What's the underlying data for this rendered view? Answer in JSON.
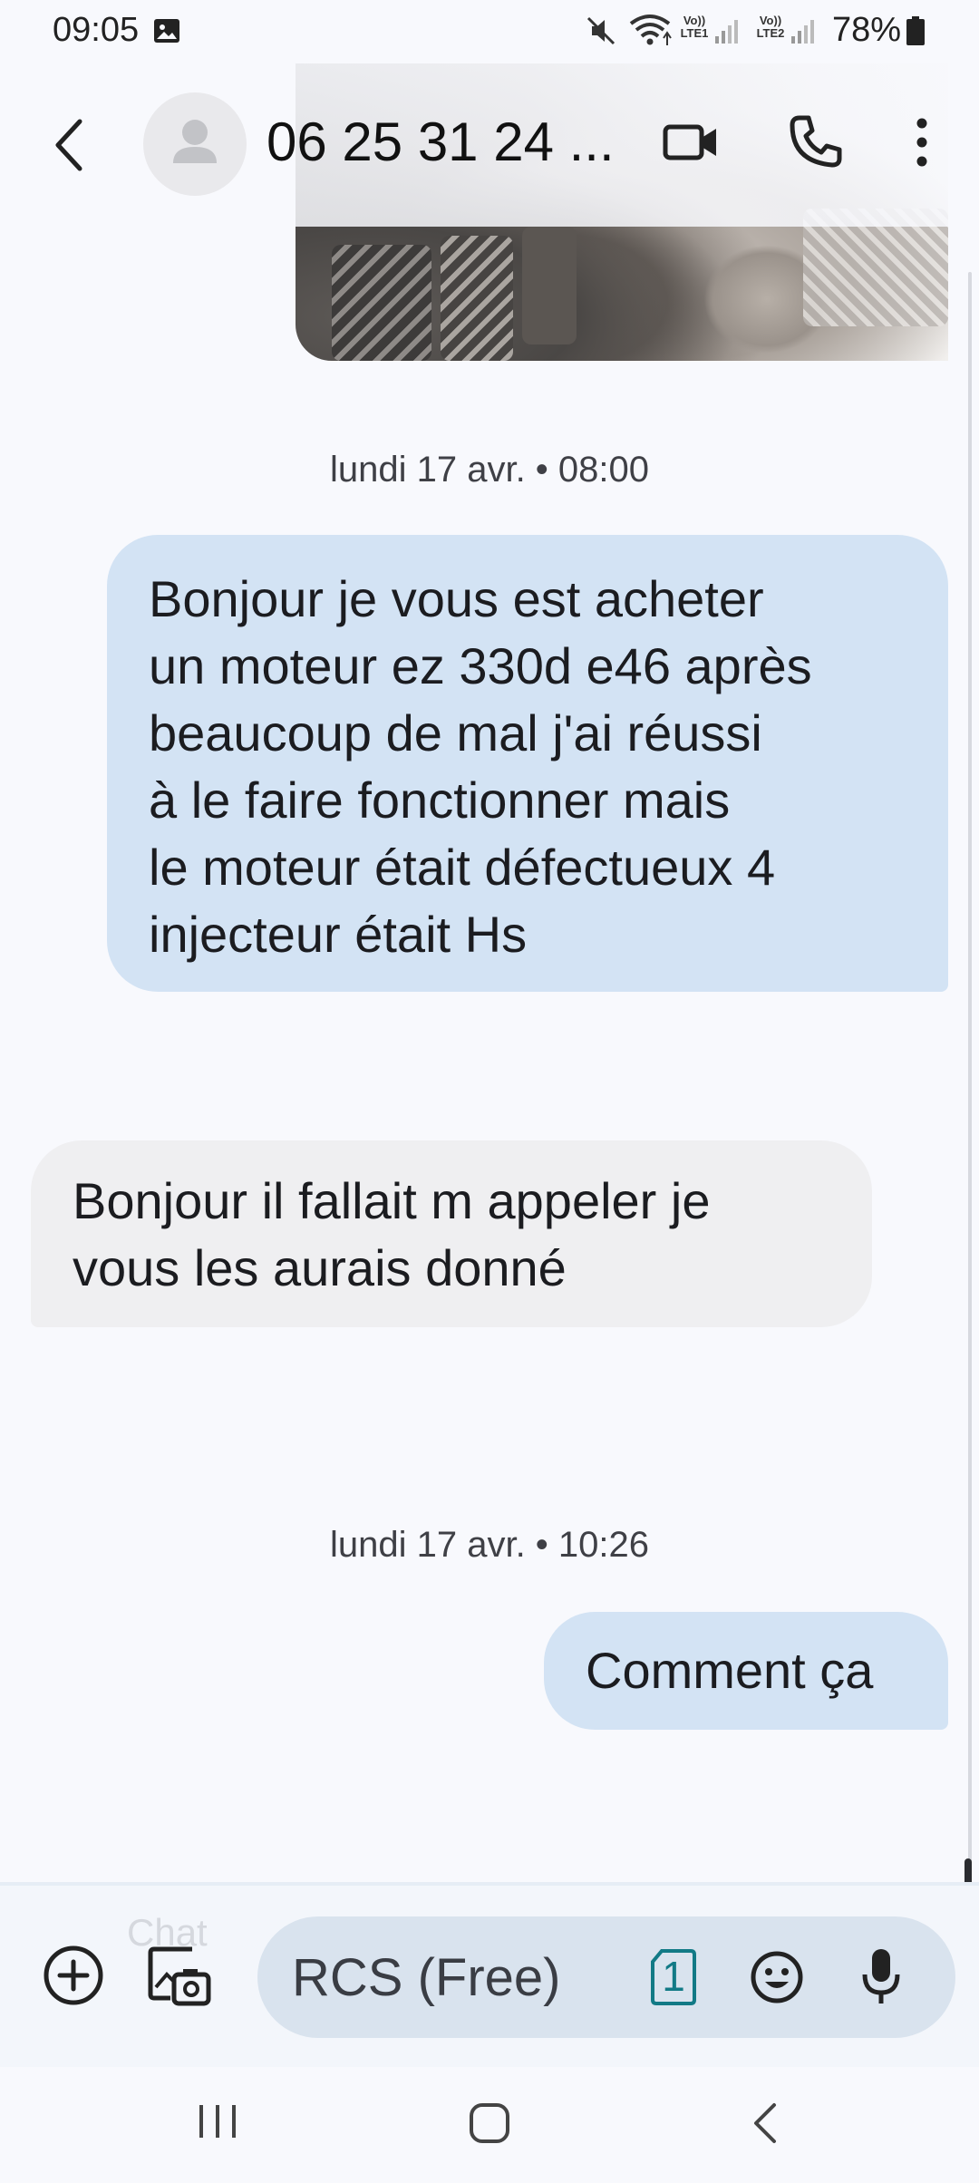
{
  "status_bar": {
    "time": "09:05",
    "battery_percent": "78%",
    "sim1_label": "Vo))\nLTE1",
    "sim2_label": "Vo))\nLTE2",
    "icons": [
      "gallery-notification-icon",
      "mute-icon",
      "wifi-icon",
      "signal-icon",
      "battery-icon"
    ]
  },
  "header": {
    "contact_name": "06 25 31 24 ...",
    "icons": [
      "back-arrow-icon",
      "avatar-person-icon",
      "video-call-icon",
      "phone-icon",
      "more-vert-icon"
    ]
  },
  "conversation": {
    "separators": [
      {
        "label": "lundi 17 avr. • 08:00"
      },
      {
        "label": "lundi 17 avr. • 10:26"
      }
    ],
    "messages": [
      {
        "direction": "outgoing",
        "lines": [
          "Bonjour je vous est acheter",
          "un moteur ez 330d e46 après",
          "beaucoup de mal j'ai réussi",
          "à le faire fonctionner mais",
          "le moteur était défectueux 4",
          "injecteur était Hs"
        ]
      },
      {
        "direction": "incoming",
        "lines": [
          "Bonjour il fallait m appeler je",
          "vous les aurais donné"
        ]
      },
      {
        "direction": "outgoing",
        "lines": [
          "Comment ça"
        ]
      }
    ]
  },
  "compose": {
    "hint": "Chat",
    "placeholder": "RCS (Free)",
    "sim_number": "1",
    "icons": [
      "add-circle-icon",
      "gallery-camera-icon",
      "sim-card-icon",
      "emoji-icon",
      "mic-icon"
    ]
  },
  "navbar": {
    "icons": [
      "recents-icon",
      "home-icon",
      "back-icon"
    ]
  },
  "colors": {
    "background": "#f8f9fd",
    "outgoing_bubble": "#d3e3f4",
    "incoming_bubble": "#efeff1",
    "input_pill": "#d9e3ee",
    "sim_accent": "#127a86"
  }
}
